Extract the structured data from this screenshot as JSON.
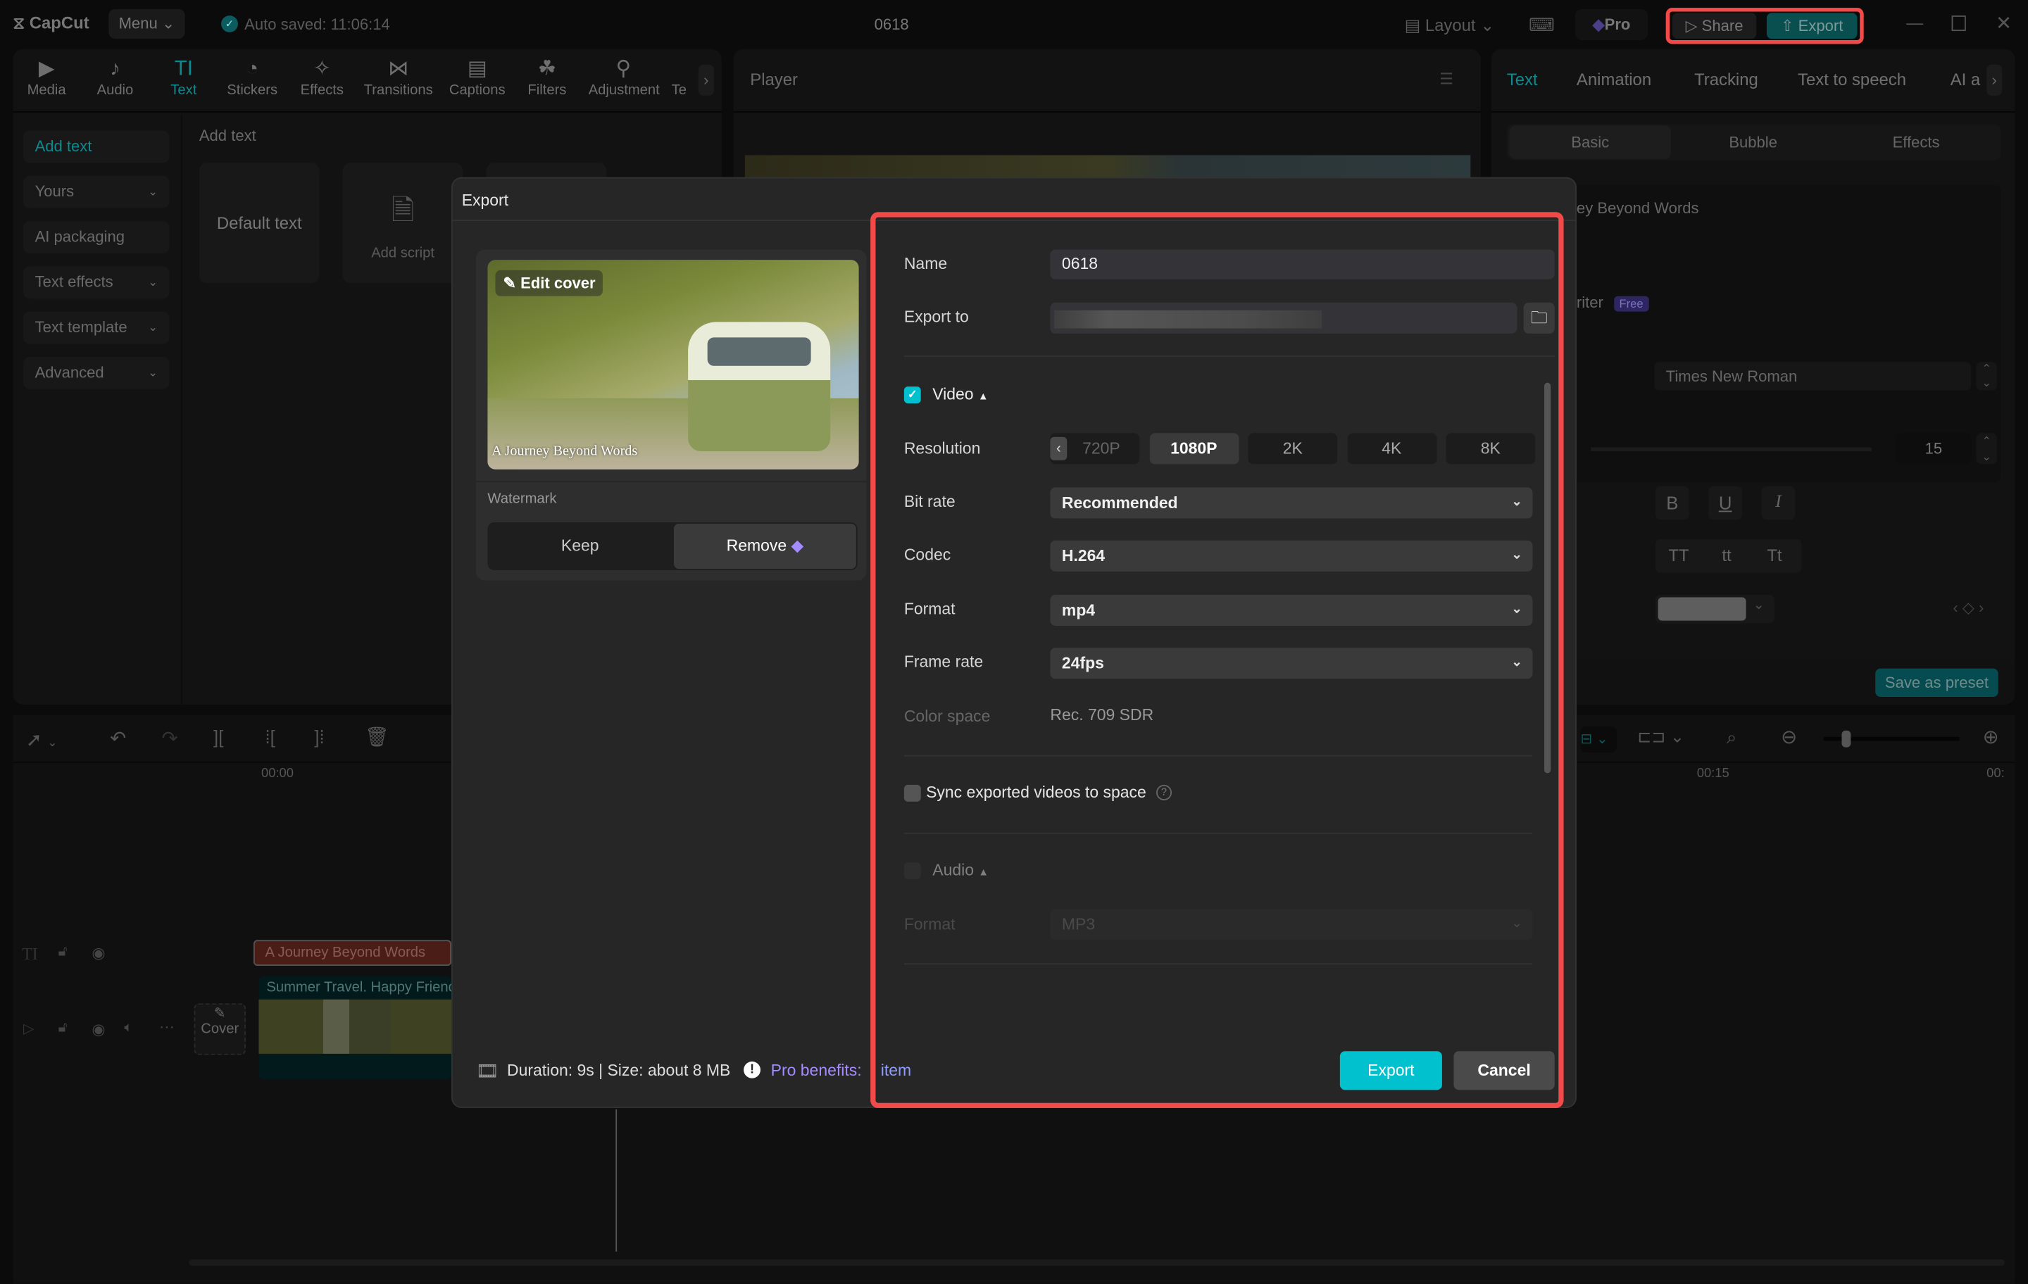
{
  "titlebar": {
    "app_name": "CapCut",
    "menu_label": "Menu",
    "autosave": "Auto saved: 11:06:14",
    "project_title": "0618",
    "layout_label": "Layout",
    "pro_label": "Pro",
    "share_label": "Share",
    "export_label": "Export"
  },
  "toolbar": {
    "items": [
      {
        "label": "Media",
        "icon": "▶"
      },
      {
        "label": "Audio",
        "icon": "♪"
      },
      {
        "label": "Text",
        "icon": "TI"
      },
      {
        "label": "Stickers",
        "icon": "◔"
      },
      {
        "label": "Effects",
        "icon": "✧"
      },
      {
        "label": "Transitions",
        "icon": "⋈"
      },
      {
        "label": "Captions",
        "icon": "▤"
      },
      {
        "label": "Filters",
        "icon": "☘"
      },
      {
        "label": "Adjustment",
        "icon": "⚲"
      },
      {
        "label": "Te",
        "icon": ""
      }
    ]
  },
  "sidebar": {
    "items": [
      "Add text",
      "Yours",
      "AI packaging",
      "Text effects",
      "Text template",
      "Advanced"
    ]
  },
  "text_library": {
    "heading": "Add text",
    "default_text": "Default text",
    "add_script": "Add script"
  },
  "player": {
    "title": "Player"
  },
  "right_panel": {
    "tabs": [
      "Text",
      "Animation",
      "Tracking",
      "Text to speech",
      "AI a"
    ],
    "subtabs": [
      "Basic",
      "Bubble",
      "Effects"
    ],
    "text_content": "ey Beyond Words",
    "writer_label": "riter",
    "free_badge": "Free",
    "font": "Times New Roman",
    "font_size": "15",
    "style_buttons": [
      "B",
      "U",
      "I"
    ],
    "case_buttons": [
      "TT",
      "tt",
      "Tt"
    ],
    "save_preset": "Save as preset"
  },
  "timeline": {
    "time_start": "00:00",
    "time_mid": "00:15",
    "time_end": "00:",
    "text_clip": "A Journey Beyond Words",
    "video_clip": "Summer Travel. Happy Friends",
    "cover_label": "Cover"
  },
  "dialog": {
    "title": "Export",
    "edit_cover": "Edit cover",
    "cover_caption": "A Journey Beyond Words",
    "watermark_label": "Watermark",
    "keep_label": "Keep",
    "remove_label": "Remove",
    "name_label": "Name",
    "name_value": "0618",
    "export_to_label": "Export to",
    "video_label": "Video",
    "video_checked": true,
    "resolution_label": "Resolution",
    "resolutions": [
      "720P",
      "1080P",
      "2K",
      "4K",
      "8K"
    ],
    "resolution_selected": "1080P",
    "bitrate_label": "Bit rate",
    "bitrate_value": "Recommended",
    "codec_label": "Codec",
    "codec_value": "H.264",
    "format_label": "Format",
    "format_value": "mp4",
    "framerate_label": "Frame rate",
    "framerate_value": "24fps",
    "colorspace_label": "Color space",
    "colorspace_value": "Rec. 709 SDR",
    "sync_label": "Sync exported videos to space",
    "sync_checked": false,
    "audio_label": "Audio",
    "audio_checked": false,
    "audio_format_label": "Format",
    "audio_format_value": "MP3",
    "footer_info": "Duration: 9s | Size: about 8 MB",
    "pro_benefits": "Pro benefits:",
    "pro_item": "item",
    "export_button": "Export",
    "cancel_button": "Cancel"
  },
  "colors": {
    "accent": "#00c1cd",
    "highlight": "#f24949",
    "pro": "#a48cff"
  }
}
